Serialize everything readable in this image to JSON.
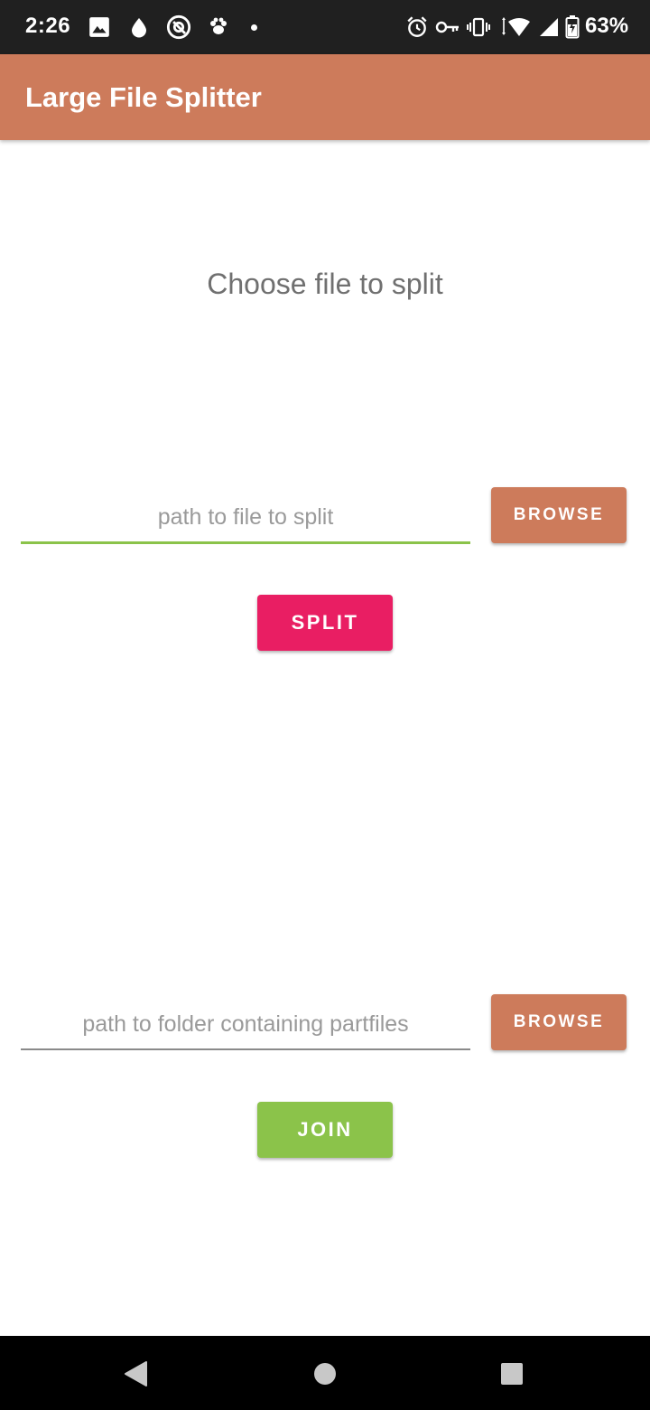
{
  "status_bar": {
    "time": "2:26",
    "battery": "63%",
    "left_icons": [
      "image-icon",
      "drop-icon",
      "at-sign-icon",
      "paw-icon",
      "dot-icon"
    ],
    "right_icons": [
      "alarm-icon",
      "key-icon",
      "vibrate-icon",
      "wifi-icon",
      "signal-icon",
      "battery-icon"
    ]
  },
  "app_bar": {
    "title": "Large File Splitter",
    "color": "#cd7b5b"
  },
  "split_section": {
    "heading": "Choose file to split",
    "file_path_placeholder": "path to file to split",
    "file_path_value": "",
    "browse_label": "BROWSE",
    "split_label": "SPLIT",
    "split_color": "#e91e63",
    "input_underline_color": "#8bc34a"
  },
  "join_section": {
    "folder_path_placeholder": "path to folder containing partfiles",
    "folder_path_value": "",
    "browse_label": "BROWSE",
    "join_label": "JOIN",
    "join_color": "#8bc34a",
    "input_underline_color": "#8a8a8a"
  },
  "nav_bar": {
    "buttons": [
      "back-icon",
      "home-icon",
      "recents-icon"
    ]
  }
}
